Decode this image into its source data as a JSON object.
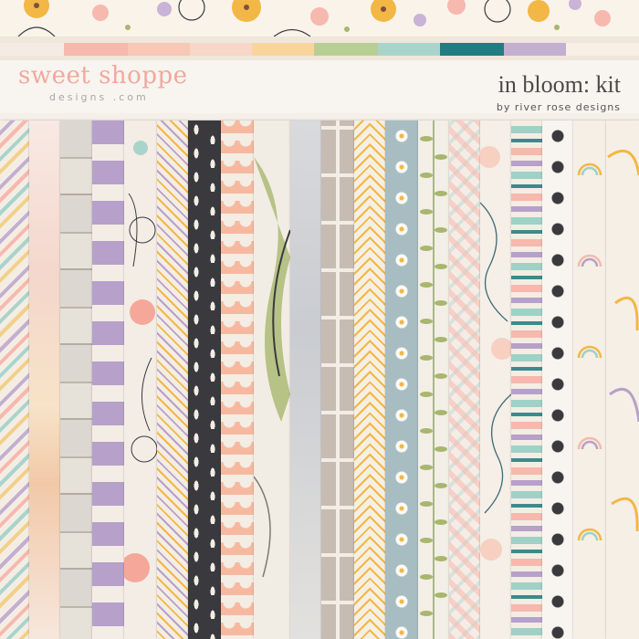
{
  "brand": {
    "name": "sweet shoppe",
    "sub": "designs .com"
  },
  "kit": {
    "title": "in bloom: kit",
    "byline": "by river rose designs"
  },
  "colors": {
    "swatches": [
      "#f4ece4",
      "#f7b8ad",
      "#f4ccbc",
      "#f9d59c",
      "#b8cf93",
      "#a9d4cc",
      "#217d82",
      "#c3afd0",
      "#f8f0e6"
    ],
    "peach": "#f6b9a0",
    "lavender": "#b7a0c9",
    "mint": "#9fd1c6",
    "charcoal": "#3a3a3e",
    "olive": "#a8b66e",
    "mustard": "#f2b744",
    "dustyblue": "#a8bdc1",
    "cream": "#f4ede4"
  },
  "papers": [
    "diagonal-stripe-pastel-icon",
    "watercolor-wash-icon",
    "wood-plank-icon",
    "lavender-stripe-icon",
    "floral-sketch-icon",
    "chevron-pastel-icon",
    "charcoal-leaf-icon",
    "peach-scallop-icon",
    "green-brushstroke-icon",
    "grey-watercolor-icon",
    "taupe-cross-icon",
    "mustard-herringbone-icon",
    "blue-daisy-icon",
    "green-fern-icon",
    "pink-plaid-icon",
    "teal-swirl-icon",
    "teal-ikat-icon",
    "rose-doodle-icon",
    "rainbow-icon",
    "mustard-loop-icon"
  ]
}
